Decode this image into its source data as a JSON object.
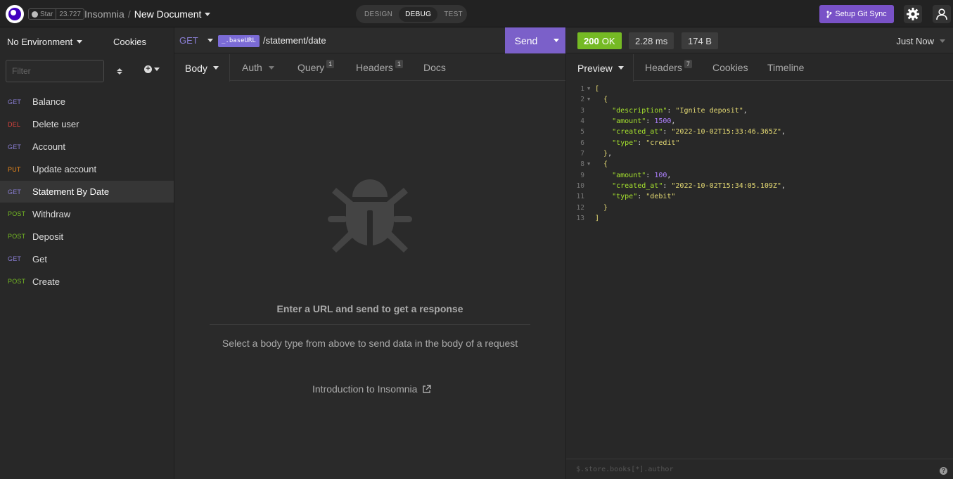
{
  "topbar": {
    "star_label": "Star",
    "star_count": "23.727",
    "project": "Insomnia",
    "separator": "/",
    "document": "New Document",
    "modes": [
      "DESIGN",
      "DEBUG",
      "TEST"
    ],
    "active_mode": "DEBUG",
    "git_sync_label": "Setup Git Sync",
    "accent_color": "#7952c7"
  },
  "sidebar": {
    "environment": "No Environment",
    "cookies_label": "Cookies",
    "filter_placeholder": "Filter",
    "requests": [
      {
        "method": "GET",
        "name": "Balance",
        "color": "#8b7fd6"
      },
      {
        "method": "DEL",
        "name": "Delete user",
        "color": "#e0443e"
      },
      {
        "method": "GET",
        "name": "Account",
        "color": "#8b7fd6"
      },
      {
        "method": "PUT",
        "name": "Update account",
        "color": "#ee8a1c"
      },
      {
        "method": "GET",
        "name": "Statement By Date",
        "color": "#8b7fd6",
        "active": true
      },
      {
        "method": "POST",
        "name": "Withdraw",
        "color": "#75ba24"
      },
      {
        "method": "POST",
        "name": "Deposit",
        "color": "#75ba24"
      },
      {
        "method": "GET",
        "name": "Get",
        "color": "#8b7fd6"
      },
      {
        "method": "POST",
        "name": "Create",
        "color": "#75ba24"
      }
    ]
  },
  "request": {
    "method": "GET",
    "base_url_tag": "_.baseURL",
    "path": "/statement/date",
    "send_label": "Send",
    "tabs": {
      "body": "Body",
      "auth": "Auth",
      "query": "Query",
      "query_count": "1",
      "headers": "Headers",
      "headers_count": "1",
      "docs": "Docs"
    },
    "empty_title": "Enter a URL and send to get a response",
    "empty_hint": "Select a body type from above to send data in the body of a request",
    "intro_link": "Introduction to Insomnia"
  },
  "response": {
    "status_code": "200",
    "status_text": "OK",
    "time": "2.28 ms",
    "size": "174 B",
    "when": "Just Now",
    "status_color": "#75ba24",
    "tabs": {
      "preview": "Preview",
      "headers": "Headers",
      "headers_count": "7",
      "cookies": "Cookies",
      "timeline": "Timeline"
    },
    "filter_placeholder": "$.store.books[*].author",
    "json": [
      {
        "description": "Ignite deposit",
        "amount": 1500,
        "created_at": "2022-10-02T15:33:46.365Z",
        "type": "credit"
      },
      {
        "amount": 100,
        "created_at": "2022-10-02T15:34:05.109Z",
        "type": "debit"
      }
    ]
  }
}
